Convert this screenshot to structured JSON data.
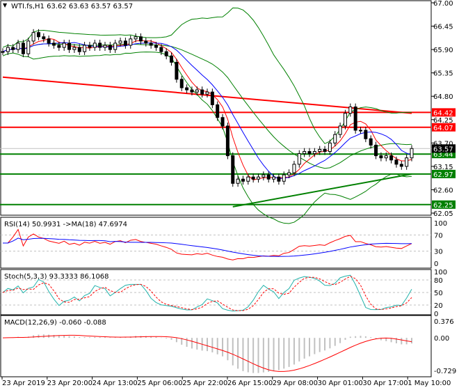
{
  "chart_data": {
    "type": "candlestick",
    "title": "WTI.fs,H1  63.62 63.63 63.57 63.57",
    "symbol": "WTI.fs",
    "timeframe": "H1",
    "ohlc_last": [
      63.62,
      63.63,
      63.57,
      63.57
    ],
    "closes": [
      65.85,
      65.95,
      65.9,
      66.05,
      65.8,
      66.1,
      66.3,
      66.2,
      66.15,
      66.05,
      66.0,
      65.95,
      66.05,
      65.9,
      65.95,
      65.85,
      66.0,
      65.95,
      66.05,
      65.95,
      66.0,
      65.9,
      66.05,
      66.1,
      66.0,
      66.15,
      66.2,
      66.1,
      66.05,
      66.0,
      65.95,
      65.85,
      65.75,
      65.6,
      65.2,
      65.0,
      64.95,
      64.9,
      64.95,
      64.85,
      64.9,
      64.6,
      64.3,
      64.1,
      63.4,
      62.75,
      62.85,
      62.8,
      62.9,
      62.85,
      62.9,
      62.95,
      62.85,
      62.9,
      62.8,
      62.95,
      63.0,
      63.2,
      63.45,
      63.5,
      63.45,
      63.5,
      63.55,
      63.5,
      63.7,
      63.9,
      64.1,
      64.4,
      64.55,
      64.0,
      64.0,
      63.8,
      63.65,
      63.4,
      63.35,
      63.4,
      63.3,
      63.2,
      63.15,
      63.35,
      63.57
    ],
    "ylim": [
      62.05,
      67.0
    ],
    "y_ticks": [
      "67.00",
      "66.45",
      "65.90",
      "65.35",
      "64.80",
      "64.25",
      "63.70",
      "63.15",
      "62.60",
      "62.05"
    ],
    "x_ticks": [
      "23 Apr 2019",
      "23 Apr 20:00",
      "24 Apr 13:00",
      "25 Apr 06:00",
      "25 Apr 22:00",
      "26 Apr 15:00",
      "29 Apr 08:00",
      "30 Apr 01:00",
      "30 Apr 17:00",
      "1 May 10:00"
    ],
    "levels": [
      {
        "price": 64.42,
        "label": "64.42",
        "color": "#ff0000"
      },
      {
        "price": 64.07,
        "label": "64.07",
        "color": "#ff0000"
      },
      {
        "price": 63.44,
        "label": "63.44",
        "color": "#008000"
      },
      {
        "price": 62.97,
        "label": "62.97",
        "color": "#008000"
      },
      {
        "price": 62.25,
        "label": "62.25",
        "color": "#008000"
      }
    ],
    "current_price": {
      "price": 63.57,
      "label": "63.57"
    },
    "trendlines": [
      {
        "from": [
          0,
          65.25
        ],
        "to": [
          80,
          64.4
        ],
        "color": "#ff0000"
      },
      {
        "from": [
          45,
          62.2
        ],
        "to": [
          80,
          62.97
        ],
        "color": "#008000"
      }
    ],
    "bollinger": {
      "period": 20,
      "dev": 2,
      "color": "#008000"
    },
    "ma_fast": {
      "period": 5,
      "color": "#ff0000"
    },
    "ma_slow": {
      "period": 10,
      "color": "#0000ff"
    },
    "rsi": {
      "label": "RSI(14) 50.9931  ->MA(18) 47.6974",
      "levels": [
        "100",
        "70",
        "30",
        "0"
      ]
    },
    "stoch": {
      "label": "Stoch(5,3,3) 93.3333 86.1068",
      "levels": [
        "100",
        "80",
        "50",
        "20",
        "0"
      ]
    },
    "macd": {
      "label": "MACD(12,26,9) -0.060 -0.088",
      "levels": [
        "0.376",
        "0.00",
        "-0.729"
      ],
      "range": [
        -0.729,
        0.376
      ]
    },
    "colors": {
      "bull": "#000000",
      "rsi": "#ff0000",
      "rsi_ma": "#0000ff",
      "stoch_main": "#20b2aa",
      "stoch_signal": "#ff0000",
      "macd_signal": "#ff0000",
      "macd_hist": "#c0c0c0"
    }
  }
}
